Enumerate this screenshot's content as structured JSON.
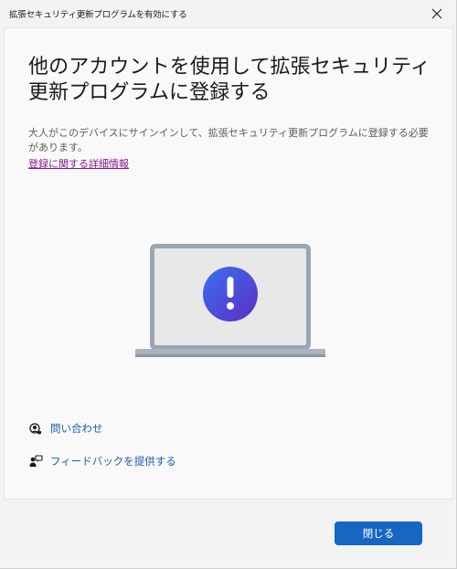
{
  "window": {
    "title": "拡張セキュリティ更新プログラムを有効にする"
  },
  "main": {
    "heading": "他のアカウントを使用して拡張セキュリティ更新プログラムに登録する",
    "description": "大人がこのデバイスにサインインして、拡張セキュリティ更新プログラムに登録する必要があります。",
    "more_link": "登録に関する詳細情報"
  },
  "help": {
    "contact_label": "問い合わせ",
    "feedback_label": "フィードバックを提供する"
  },
  "footer": {
    "close_label": "閉じる"
  },
  "colors": {
    "accent": "#1667c2",
    "link_visited": "#8b1889",
    "help_link": "#1b5cb3"
  },
  "icons": {
    "close": "close-icon",
    "contact": "contact-support-icon",
    "feedback": "feedback-icon",
    "illustration": "laptop-alert-illustration"
  }
}
